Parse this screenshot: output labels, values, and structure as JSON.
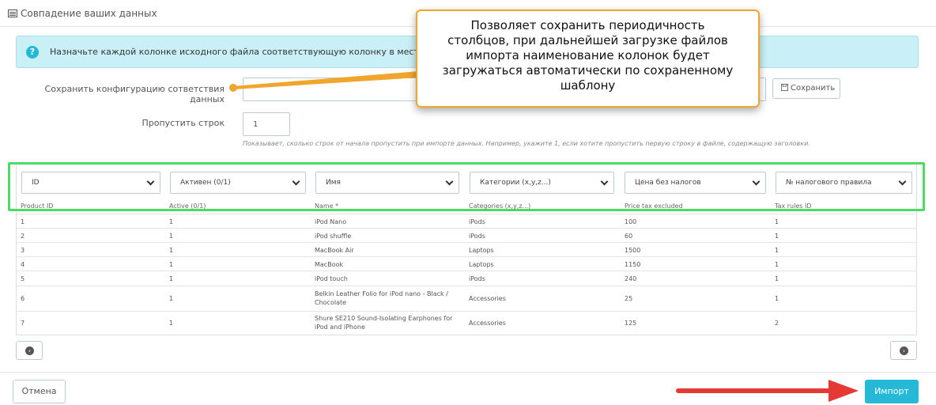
{
  "header": {
    "title": "Совпадение ваших данных",
    "icon": "table-icon"
  },
  "info": {
    "icon": "question-icon",
    "text": "Назначьте каждой колонке исходного файла соответствующую колонку в месте назначен"
  },
  "config": {
    "label": "Сохранить конфигурацию сответствия данных",
    "value": "",
    "save_label": "Сохранить",
    "save_icon": "floppy-icon"
  },
  "skip": {
    "label": "Пропустить строк",
    "value": "1",
    "hint": "Показывает, сколько строк от начала пропустить при импорте данных. Например, укажите 1, если хотите пропустить первую строку в файле, содержащую заголовки."
  },
  "callout": {
    "lines": [
      "Позволяет сохранить периодичность",
      "столбцов, при дальнейшей загрузке файлов",
      "импорта наименование колонок будет",
      "загружаться автоматически по сохраненному",
      "шаблону"
    ],
    "border_color": "#f0a52c"
  },
  "mapping": {
    "selects": [
      "ID",
      "Активен (0/1)",
      "Имя",
      "Категории (x,y,z...)",
      "Цена без налогов",
      "№ налогового правила"
    ],
    "highlight_color": "#4cd964"
  },
  "table": {
    "headers": [
      "Product ID",
      "Active (0/1)",
      "Name *",
      "Categories (x,y,z...)",
      "Price tax excluded",
      "Tax rules ID"
    ],
    "rows": [
      [
        "1",
        "1",
        "iPod Nano",
        "iPods",
        "100",
        "1"
      ],
      [
        "2",
        "1",
        "iPod shuffle",
        "iPods",
        "60",
        "1"
      ],
      [
        "3",
        "1",
        "MacBook Air",
        "Laptops",
        "1500",
        "1"
      ],
      [
        "4",
        "1",
        "MacBook",
        "Laptops",
        "1150",
        "1"
      ],
      [
        "5",
        "1",
        "iPod touch",
        "iPods",
        "240",
        "1"
      ],
      [
        "6",
        "1",
        "Belkin Leather Folio for iPod nano - Black / Chocolate",
        "Accessories",
        "25",
        "1"
      ],
      [
        "7",
        "1",
        "Shure SE210 Sound-Isolating Earphones for iPod and iPhone",
        "Accessories",
        "125",
        "2"
      ]
    ]
  },
  "pagination": {
    "prev_icon": "chevron-left-icon",
    "next_icon": "chevron-right-icon",
    "prev_glyph": "‹",
    "next_glyph": "›"
  },
  "footer": {
    "cancel_label": "Отмена",
    "import_label": "Импорт",
    "accent": "#25b9d7",
    "arrow_color": "#e53935"
  }
}
